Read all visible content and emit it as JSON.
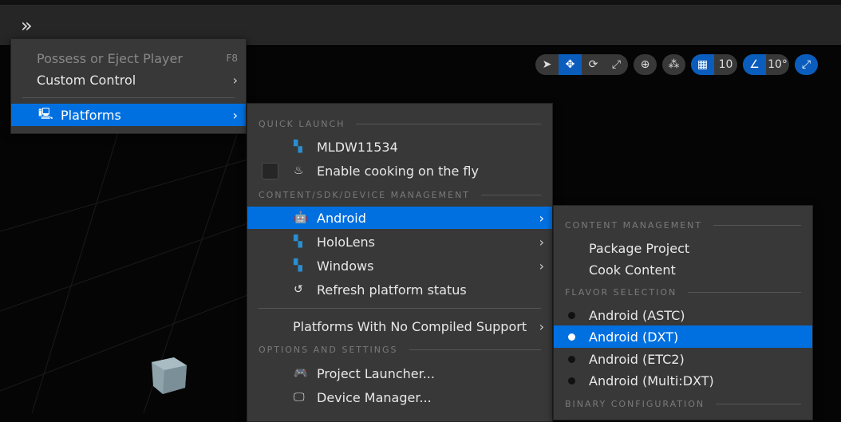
{
  "toolbar": {
    "expand_icon": "double-chevron-right",
    "snap_grid": "10",
    "snap_angle": "10°"
  },
  "menu1": {
    "items": [
      {
        "label": "Possess or Eject Player",
        "shortcut": "F8"
      },
      {
        "label": "Custom Control"
      },
      {
        "label": "Platforms"
      }
    ]
  },
  "menu2": {
    "quick_launch": "QUICK LAUNCH",
    "device": "MLDW11534",
    "cooking": "Enable cooking on the fly",
    "content_header": "CONTENT/SDK/DEVICE MANAGEMENT",
    "platforms": [
      "Android",
      "HoloLens",
      "Windows"
    ],
    "refresh": "Refresh platform status",
    "no_support": "Platforms With No Compiled Support",
    "options_header": "OPTIONS AND SETTINGS",
    "launcher": "Project Launcher...",
    "device_manager": "Device Manager..."
  },
  "menu3": {
    "content_header": "CONTENT MANAGEMENT",
    "package": "Package Project",
    "cook": "Cook Content",
    "flavor_header": "FLAVOR SELECTION",
    "flavors": [
      "Android (ASTC)",
      "Android (DXT)",
      "Android (ETC2)",
      "Android (Multi:DXT)"
    ],
    "selected_flavor": "Android (DXT)",
    "binary_header": "BINARY CONFIGURATION"
  },
  "colors": {
    "highlight": "#0070e0",
    "menu_bg": "#383838"
  }
}
